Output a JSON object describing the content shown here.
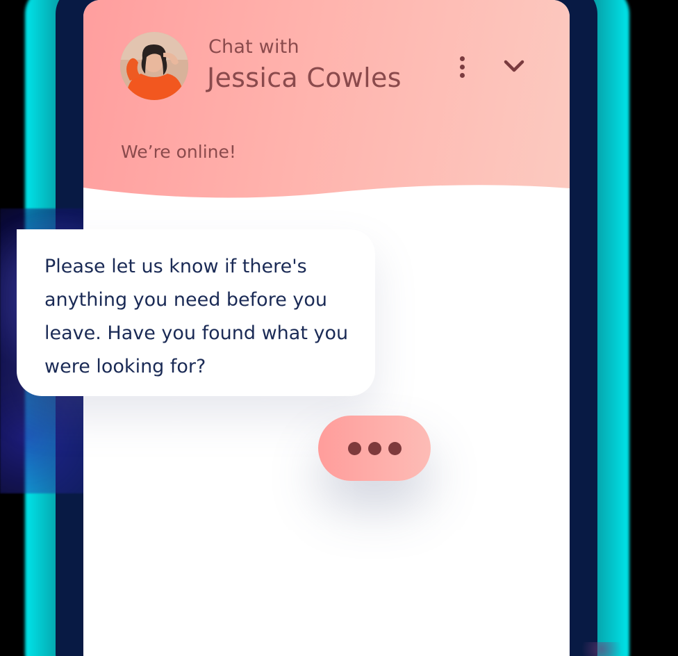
{
  "header": {
    "chat_with": "Chat with",
    "agent_name": "Jessica Cowles",
    "status": "We’re online!",
    "avatar_icon": "agent-avatar",
    "more_icon": "more-vertical-icon",
    "collapse_icon": "chevron-down-icon"
  },
  "message": {
    "text": "Please let us know if there's anything you need before you leave. Have you found what you were looking for?"
  },
  "typing_indicator": {
    "icon": "typing-dots-icon"
  },
  "colors": {
    "header_gradient_start": "#ff9e9e",
    "header_gradient_end": "#fccac0",
    "header_text": "#8a4a4c",
    "message_text": "#1a2a55",
    "typing_dot": "#7e3a3c"
  }
}
